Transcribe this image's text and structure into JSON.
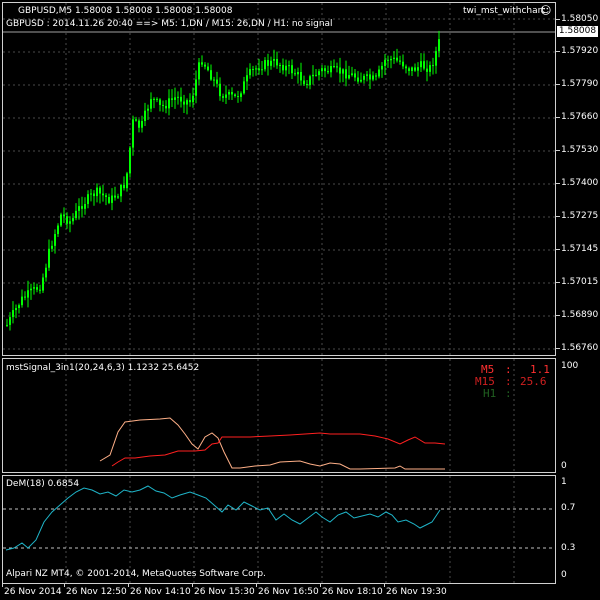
{
  "colors": {
    "background": "#000000",
    "grid": "#4a4a4a",
    "frame": "#d0d0d0",
    "candle": "#00ff00",
    "dem_line": "#1fb5c9",
    "signal_red": "#ff2020",
    "signal_light": "#ffb088",
    "label_m5": "#ff3030",
    "label_m15": "#d02020",
    "label_h1": "#206020"
  },
  "main": {
    "symbol_header": "GBPUSD,M5  1.58008 1.58008 1.58008 1.58008",
    "signal_text": "GBPUSD : 2014.11.26 20:40 ==> M5: 1,DN / M15: 26,DN / H1: no signal",
    "indicator_name": "twi_mst_withchart",
    "smiley_icon": "smiley-icon",
    "current_price": "1.58008",
    "price_labels": [
      "1.58050",
      "1.57920",
      "1.57790",
      "1.57660",
      "1.57530",
      "1.57400",
      "1.57275",
      "1.57145",
      "1.57015",
      "1.56890",
      "1.56760"
    ]
  },
  "ind1": {
    "title": "mstSignal_3in1(20,24,6,3) 1.1232 25.6452",
    "scale_top": "100",
    "scale_bottom": "0",
    "m5_label": "M5",
    "m5_value": "1.1",
    "m15_label": "M15",
    "m15_value": "25.6",
    "h1_label": "H1"
  },
  "ind2": {
    "title": "DeM(18) 0.6854",
    "scale": [
      "1",
      "0.7",
      "0.3",
      "0"
    ]
  },
  "footer": {
    "copyright": "Alpari NZ MT4, © 2001-2014, MetaQuotes Software Corp."
  },
  "time_axis": [
    "26 Nov 2014",
    "26 Nov 12:50",
    "26 Nov 14:10",
    "26 Nov 15:30",
    "26 Nov 16:50",
    "26 Nov 18:10",
    "26 Nov 19:30"
  ]
}
